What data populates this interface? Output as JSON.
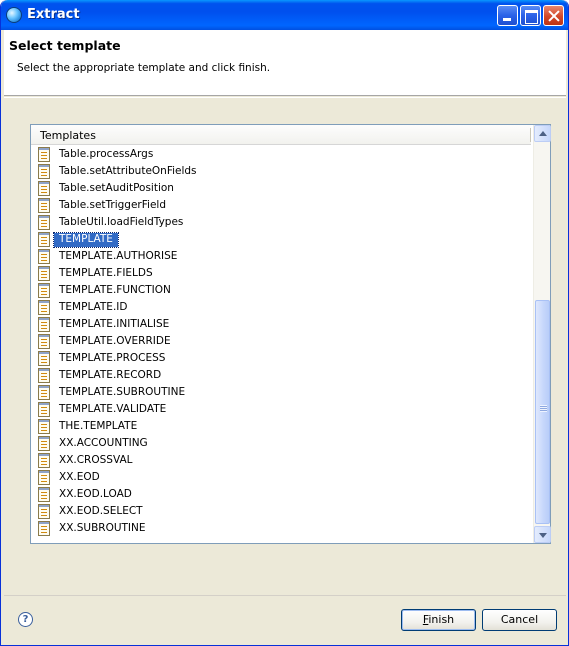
{
  "window": {
    "title": "Extract"
  },
  "header": {
    "title": "Select template",
    "description": "Select the appropriate template and click finish."
  },
  "list": {
    "column_header": "Templates",
    "items": [
      "Table.processArgs",
      "Table.setAttributeOnFields",
      "Table.setAuditPosition",
      "Table.setTriggerField",
      "TableUtil.loadFieldTypes",
      "TEMPLATE",
      "TEMPLATE.AUTHORISE",
      "TEMPLATE.FIELDS",
      "TEMPLATE.FUNCTION",
      "TEMPLATE.ID",
      "TEMPLATE.INITIALISE",
      "TEMPLATE.OVERRIDE",
      "TEMPLATE.PROCESS",
      "TEMPLATE.RECORD",
      "TEMPLATE.SUBROUTINE",
      "TEMPLATE.VALIDATE",
      "THE.TEMPLATE",
      "XX.ACCOUNTING",
      "XX.CROSSVAL",
      "XX.EOD",
      "XX.EOD.LOAD",
      "XX.EOD.SELECT",
      "XX.SUBROUTINE"
    ],
    "selected_item": "TEMPLATE",
    "item_icon": "template-file-icon"
  },
  "footer": {
    "help_glyph": "?",
    "finish_label_mnemonic": "F",
    "finish_label_rest": "inish",
    "cancel_label": "Cancel"
  }
}
